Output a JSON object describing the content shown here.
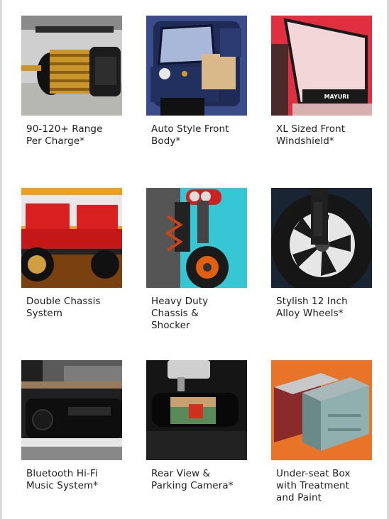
{
  "features": [
    {
      "label": "90-120+ Range\nPer Charge*",
      "image": "motor-icon"
    },
    {
      "label": "Auto Style Front\nBody*",
      "image": "front-body-icon"
    },
    {
      "label": "XL Sized Front\nWindshield*",
      "image": "windshield-icon"
    },
    {
      "label": "Double Chassis\nSystem",
      "image": "chassis-icon"
    },
    {
      "label": "Heavy Duty\nChassis &\nShocker",
      "image": "shocker-icon"
    },
    {
      "label": "Stylish 12 Inch\nAlloy Wheels*",
      "image": "alloy-wheel-icon"
    },
    {
      "label": "Bluetooth Hi-Fi\nMusic System*",
      "image": "music-system-icon"
    },
    {
      "label": "Rear View &\nParking Camera*",
      "image": "camera-icon"
    },
    {
      "label": "Under-seat Box\nwith Treatment\nand Paint",
      "image": "storage-box-icon"
    }
  ],
  "windshield_brand": "MAYURI",
  "colors": {
    "accent_red": "#e8312f",
    "teal": "#37c6d3",
    "orange": "#e8742a",
    "text": "#1f1f1f"
  }
}
